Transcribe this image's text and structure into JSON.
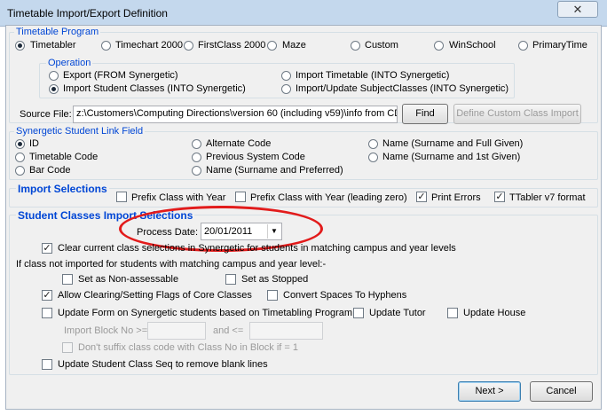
{
  "window": {
    "title": "Timetable Import/Export Definition",
    "close_glyph": "✕"
  },
  "timetable_program": {
    "title": "Timetable Program",
    "options": [
      {
        "label": "Timetabler",
        "selected": true
      },
      {
        "label": "Timechart 2000",
        "selected": false
      },
      {
        "label": "FirstClass 2000",
        "selected": false
      },
      {
        "label": "Maze",
        "selected": false
      },
      {
        "label": "Custom",
        "selected": false
      },
      {
        "label": "WinSchool",
        "selected": false
      },
      {
        "label": "PrimaryTime",
        "selected": false
      }
    ]
  },
  "operation": {
    "title": "Operation",
    "options": [
      {
        "label": "Export (FROM Synergetic)",
        "selected": false
      },
      {
        "label": "Import Timetable (INTO Synergetic)",
        "selected": false
      },
      {
        "label": "Import Student Classes (INTO Synergetic)",
        "selected": true
      },
      {
        "label": "Import/Update SubjectClasses (INTO Synergetic)",
        "selected": false
      }
    ]
  },
  "source_file": {
    "label": "Source File:",
    "value": "z:\\Customers\\Computing Directions\\version 60 (including v59)\\info from CD",
    "find_label": "Find",
    "custom_label": "Define Custom Class Import"
  },
  "link_field": {
    "title": "Synergetic Student Link Field",
    "options": [
      {
        "label": "ID",
        "selected": true
      },
      {
        "label": "Alternate Code",
        "selected": false
      },
      {
        "label": "Name (Surname and Full Given)",
        "selected": false
      },
      {
        "label": "Timetable Code",
        "selected": false
      },
      {
        "label": "Previous System Code",
        "selected": false
      },
      {
        "label": "Name (Surname and 1st Given)",
        "selected": false
      },
      {
        "label": "Bar Code",
        "selected": false
      },
      {
        "label": "Name (Surname and Preferred)",
        "selected": false
      }
    ]
  },
  "import_selections": {
    "title": "Import Selections",
    "options": [
      {
        "label": "Prefix Class with Year",
        "checked": false
      },
      {
        "label": "Prefix Class with Year (leading zero)",
        "checked": false
      },
      {
        "label": "Print Errors",
        "checked": true
      },
      {
        "label": "TTabler v7 format",
        "checked": true
      }
    ]
  },
  "student_classes": {
    "title": "Student Classes Import Selections",
    "process_date_label": "Process Date:",
    "process_date": "20/01/2011",
    "clear_current": {
      "label": "Clear current class selections in Synergetic for students in matching campus and year levels",
      "checked": true
    },
    "not_imported_text": "If class not imported for students with matching campus and year level:-",
    "set_non_assessable": {
      "label": "Set as Non-assessable",
      "checked": false
    },
    "set_stopped": {
      "label": "Set as Stopped",
      "checked": false
    },
    "allow_clearing": {
      "label": "Allow Clearing/Setting Flags of Core Classes",
      "checked": true
    },
    "convert_spaces": {
      "label": "Convert Spaces To Hyphens",
      "checked": false
    },
    "update_form": {
      "label": "Update Form on Synergetic students based on Timetabling Program",
      "checked": false
    },
    "update_tutor": {
      "label": "Update Tutor",
      "checked": false
    },
    "update_house": {
      "label": "Update House",
      "checked": false
    },
    "import_block_label": "Import Block No >=",
    "and_label": "and <=",
    "dont_suffix": {
      "label": "Don't suffix class code with Class No in Block if = 1",
      "checked": false
    },
    "update_seq": {
      "label": "Update Student Class Seq to remove blank lines",
      "checked": false
    }
  },
  "footer": {
    "next_label": "Next >",
    "cancel_label": "Cancel"
  }
}
